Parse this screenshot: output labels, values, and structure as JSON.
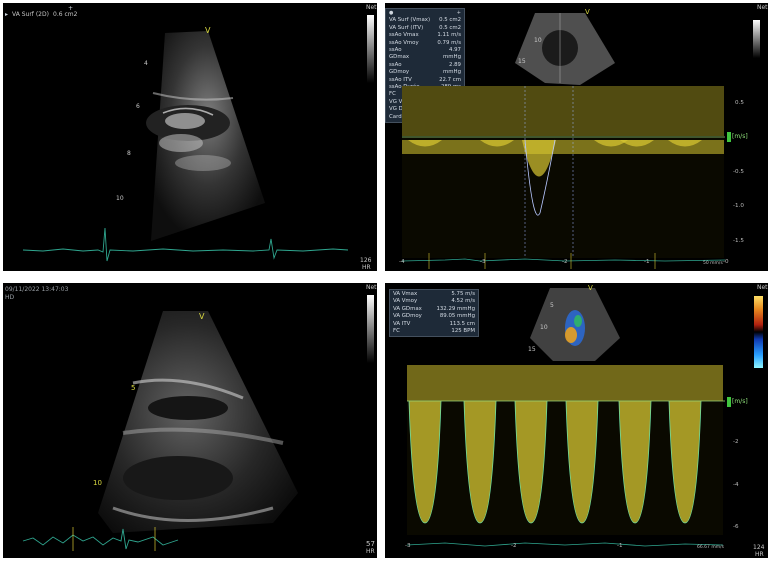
{
  "tl": {
    "meas_label": "VA Surf (2D)",
    "meas_value": "0.6 cm2",
    "depths": [
      "4",
      "6",
      "8",
      "10"
    ],
    "net_label": "Net",
    "hr_value": "126",
    "hr_unit": "HR",
    "v_marker": "V"
  },
  "tr": {
    "net_label": "Net",
    "v_marker": "V",
    "depth_a": "10",
    "depth_b": "15",
    "measurements": [
      {
        "label": "VA Surf (Vmax)",
        "value": "0.5 cm2"
      },
      {
        "label": "VA Surf (ITV)",
        "value": "0.5 cm2"
      },
      {
        "label": "ssAo Vmax",
        "value": "1.11 m/s"
      },
      {
        "label": "ssAo Vmoy",
        "value": "0.79 m/s"
      },
      {
        "label": "ssAo GDmax",
        "value": "4.97 mmHg"
      },
      {
        "label": "ssAo GDmoy",
        "value": "2.89 mmHg"
      },
      {
        "label": "ssAo ITV",
        "value": "22.7 cm"
      },
      {
        "label": "ssAo Durée",
        "value": "289 ms"
      },
      {
        "label": "FC",
        "value": "105 BPM"
      },
      {
        "label": "VG Véjec (dop)",
        "value": "55 ml"
      },
      {
        "label": "VG Débit Card",
        "value": "5.81 l/min"
      }
    ],
    "y_ticks": [
      "0.5",
      "-0.5",
      "-1.0",
      "-1.5"
    ],
    "unit": "[m/s]",
    "x_ticks": [
      "-4",
      "-3",
      "-2",
      "-1"
    ],
    "sweep": "50 mm/s",
    "sweep_end": "-0"
  },
  "bl": {
    "timestamp": "09/11/2022 13:47:03",
    "mode": "HD",
    "net_label": "Net",
    "depths": [
      "5",
      "10"
    ],
    "hr_value": "57",
    "hr_unit": "HR",
    "v_marker": "V"
  },
  "br": {
    "net_label": "Net",
    "v_marker": "V",
    "depth_a": "5",
    "depth_b": "10",
    "depth_c": "15",
    "measurements": [
      {
        "label": "VA Vmax",
        "value": "5.75 m/s"
      },
      {
        "label": "VA Vmoy",
        "value": "4.52 m/s"
      },
      {
        "label": "VA GDmax",
        "value": "132.29 mmHg"
      },
      {
        "label": "VA GDmoy",
        "value": "89.05 mmHg"
      },
      {
        "label": "VA ITV",
        "value": "113.5 cm"
      },
      {
        "label": "FC",
        "value": "125 BPM"
      }
    ],
    "unit": "[m/s]",
    "y_ticks": [
      "-2",
      "-4",
      "-6"
    ],
    "x_ticks": [
      "-3",
      "-2",
      "-1"
    ],
    "sweep": "66.67 mm/s",
    "hr_value": "124",
    "hr_unit": "HR"
  },
  "colors": {
    "doppler": "#d8c832",
    "ecg": "#2fa68f",
    "panel": "#000000",
    "meas_box": "#1e2a38"
  }
}
